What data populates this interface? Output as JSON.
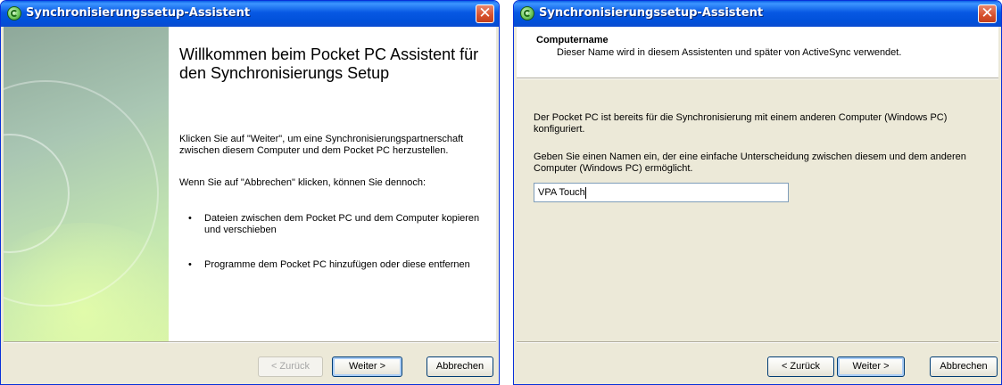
{
  "window1": {
    "title": "Synchronisierungssetup-Assistent",
    "heading": "Willkommen beim Pocket PC Assistent für den Synchronisierungs Setup",
    "para1": "Klicken Sie auf \"Weiter\", um eine Synchronisierungspartnerschaft zwischen diesem Computer und dem Pocket PC herzustellen.",
    "para2": "Wenn Sie auf \"Abbrechen\" klicken, können Sie dennoch:",
    "bullets": [
      "Dateien zwischen dem Pocket PC und dem Computer kopieren und verschieben",
      "Programme dem Pocket PC hinzufügen oder diese entfernen"
    ],
    "buttons": {
      "back": "< Zurück",
      "next": "Weiter >",
      "cancel": "Abbrechen"
    }
  },
  "window2": {
    "title": "Synchronisierungssetup-Assistent",
    "section_title": "Computername",
    "section_subtitle": "Dieser Name wird in diesem Assistenten und später von ActiveSync verwendet.",
    "para1": "Der Pocket PC ist bereits für die Synchronisierung mit einem anderen Computer (Windows PC) konfiguriert.",
    "para2": "Geben Sie einen Namen ein, der eine einfache Unterscheidung zwischen diesem und dem anderen Computer (Windows PC) ermöglicht.",
    "name_value": "VPA Touch",
    "buttons": {
      "back": "< Zurück",
      "next": "Weiter >",
      "cancel": "Abbrechen"
    }
  },
  "colors": {
    "titlebar": "#0058e6",
    "dialog_bg": "#ece9d8",
    "close": "#d7502c"
  }
}
